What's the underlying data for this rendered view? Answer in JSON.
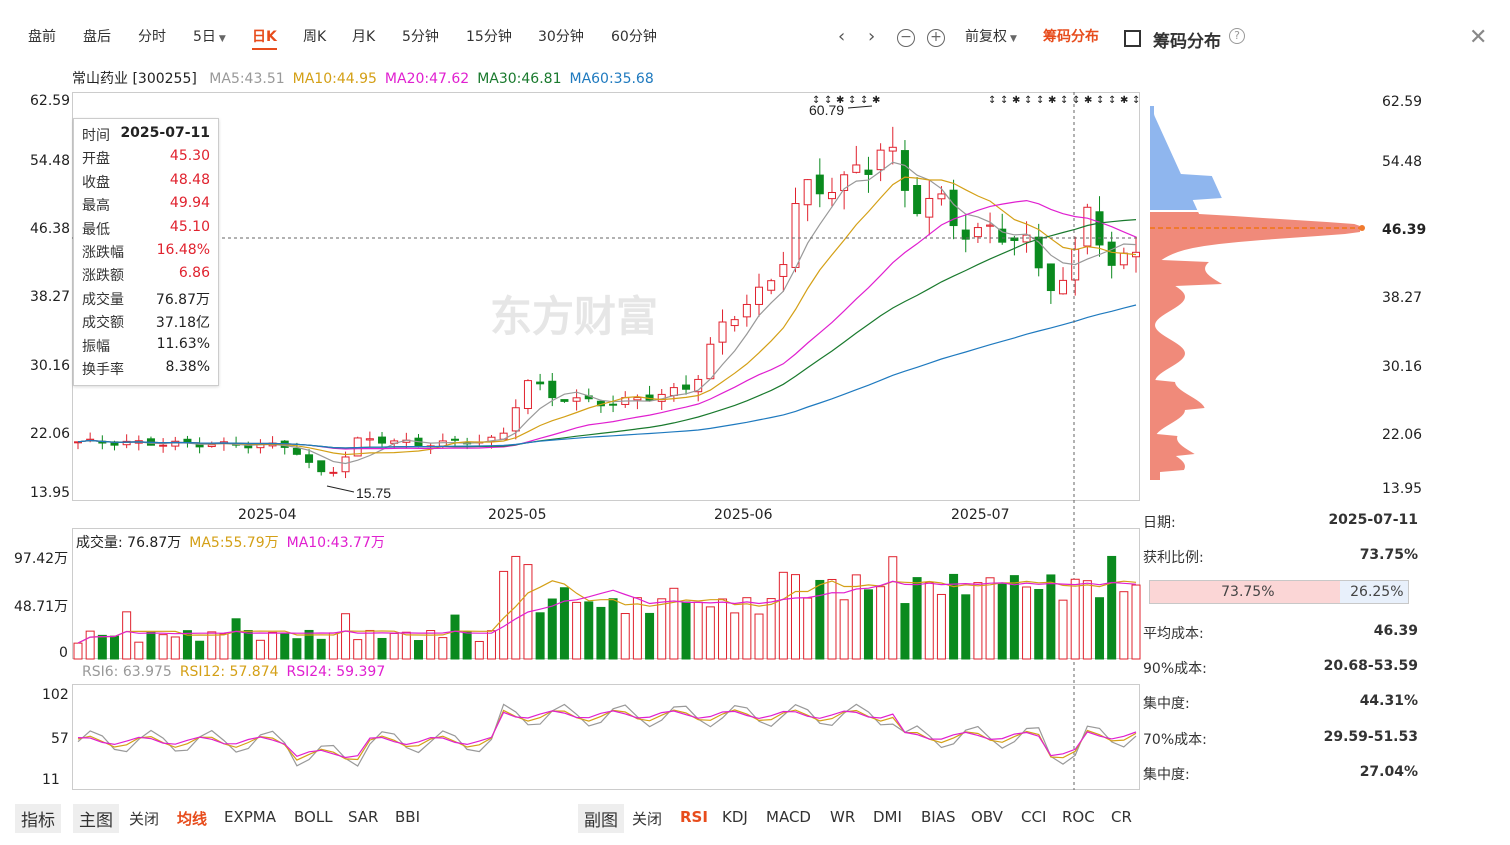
{
  "toolbar": {
    "tabs": [
      {
        "label": "盘前",
        "active": false
      },
      {
        "label": "盘后",
        "active": false
      },
      {
        "label": "分时",
        "active": false
      },
      {
        "label": "5日",
        "active": false,
        "dropdown": true
      },
      {
        "label": "日K",
        "active": true
      },
      {
        "label": "周K",
        "active": false
      },
      {
        "label": "月K",
        "active": false
      },
      {
        "label": "5分钟",
        "active": false
      },
      {
        "label": "15分钟",
        "active": false
      },
      {
        "label": "30分钟",
        "active": false
      },
      {
        "label": "60分钟",
        "active": false
      }
    ],
    "adjust_label": "前复权",
    "chip_label": "筹码分布",
    "chip_panel_title": "筹码分布",
    "icons": [
      "chevron-left-icon",
      "chevron-right-icon",
      "zoom-out-icon",
      "zoom-in-icon",
      "expand-icon",
      "help-icon",
      "close-icon"
    ]
  },
  "stock": {
    "name": "常山药业 [300255]",
    "ma": [
      {
        "label": "MA5:43.51",
        "color": "#999999"
      },
      {
        "label": "MA10:44.95",
        "color": "#d4a017"
      },
      {
        "label": "MA20:47.62",
        "color": "#e020d0"
      },
      {
        "label": "MA30:46.81",
        "color": "#1a7a2e"
      },
      {
        "label": "MA60:35.68",
        "color": "#1f7abf"
      }
    ]
  },
  "price_axis": {
    "ticks": [
      "62.59",
      "54.48",
      "46.38",
      "38.27",
      "30.16",
      "22.06",
      "13.95"
    ]
  },
  "date_axis": {
    "ticks": [
      "2025-04",
      "2025-05",
      "2025-06",
      "2025-07"
    ]
  },
  "annotations": {
    "high": "60.79",
    "low": "15.75"
  },
  "watermark": "东方财富",
  "tooltip": [
    {
      "k": "时间",
      "v": "2025-07-11",
      "color": "#222"
    },
    {
      "k": "开盘",
      "v": "45.30",
      "color": "#e0222e"
    },
    {
      "k": "收盘",
      "v": "48.48",
      "color": "#e0222e"
    },
    {
      "k": "最高",
      "v": "49.94",
      "color": "#e0222e"
    },
    {
      "k": "最低",
      "v": "45.10",
      "color": "#e0222e"
    },
    {
      "k": "涨跌幅",
      "v": "16.48%",
      "color": "#e0222e"
    },
    {
      "k": "涨跌额",
      "v": "6.86",
      "color": "#e0222e"
    },
    {
      "k": "成交量",
      "v": "76.87万",
      "color": "#222"
    },
    {
      "k": "成交额",
      "v": "37.18亿",
      "color": "#222"
    },
    {
      "k": "振幅",
      "v": "11.63%",
      "color": "#222"
    },
    {
      "k": "换手率",
      "v": "8.38%",
      "color": "#222"
    }
  ],
  "volume": {
    "header": [
      {
        "label": "成交量: 76.87万",
        "color": "#222"
      },
      {
        "label": "MA5:55.79万",
        "color": "#d4a017"
      },
      {
        "label": "MA10:43.77万",
        "color": "#e020d0"
      }
    ],
    "ticks": [
      "97.42万",
      "48.71万",
      "0"
    ]
  },
  "rsi": {
    "header": [
      {
        "label": "RSI6: 63.975",
        "color": "#999999"
      },
      {
        "label": "RSI12: 57.874",
        "color": "#d4a017"
      },
      {
        "label": "RSI24: 59.397",
        "color": "#e020d0"
      }
    ],
    "ticks": [
      "102",
      "57",
      "11"
    ]
  },
  "chip": {
    "price_ticks": [
      "62.59",
      "54.48",
      "46.39",
      "38.27",
      "30.16",
      "22.06",
      "13.95"
    ],
    "rows": [
      {
        "k": "日期:",
        "v": "2025-07-11"
      },
      {
        "k": "获利比例:",
        "v": "73.75%"
      },
      {
        "k": "平均成本:",
        "v": "46.39"
      },
      {
        "k": "90%成本:",
        "v": "20.68-53.59"
      },
      {
        "k": "集中度:",
        "v": "44.31%"
      },
      {
        "k": "70%成本:",
        "v": "29.59-51.53"
      },
      {
        "k": "集中度:",
        "v": "27.04%"
      }
    ],
    "profit_pct": 73.75,
    "profit_label": "73.75%",
    "loss_label": "26.25%"
  },
  "bottom_left": {
    "boxed": [
      "指标",
      "主图"
    ],
    "items": [
      {
        "label": "关闭",
        "active": false
      },
      {
        "label": "均线",
        "active": true
      },
      {
        "label": "EXPMA",
        "active": false
      },
      {
        "label": "BOLL",
        "active": false
      },
      {
        "label": "SAR",
        "active": false
      },
      {
        "label": "BBI",
        "active": false
      }
    ]
  },
  "bottom_right": {
    "boxed": [
      "副图"
    ],
    "items": [
      {
        "label": "关闭",
        "active": false
      },
      {
        "label": "RSI",
        "active": true
      },
      {
        "label": "KDJ",
        "active": false
      },
      {
        "label": "MACD",
        "active": false
      },
      {
        "label": "WR",
        "active": false
      },
      {
        "label": "DMI",
        "active": false
      },
      {
        "label": "BIAS",
        "active": false
      },
      {
        "label": "OBV",
        "active": false
      },
      {
        "label": "CCI",
        "active": false
      },
      {
        "label": "ROC",
        "active": false
      },
      {
        "label": "CR",
        "active": false
      }
    ]
  },
  "colors": {
    "up": "#e0222e",
    "down": "#0a8a1e",
    "accent": "#e74c1c"
  }
}
